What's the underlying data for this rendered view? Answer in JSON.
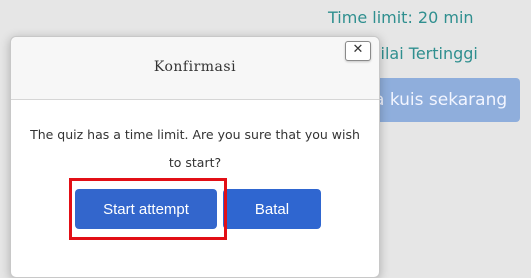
{
  "background": {
    "time_limit": "Time limit: 20 min",
    "grading_method": "hod: Nilai Tertinggi",
    "start_button_label": "a kuis sekarang"
  },
  "modal": {
    "title": "Konfirmasi",
    "close_symbol": "✕",
    "message": "The quiz has a time limit. Are you sure that you wish to start?",
    "primary_button": "Start attempt",
    "secondary_button": "Batal"
  },
  "colors": {
    "accent": "#3366cc",
    "highlight": "#e20f16"
  },
  "icons": {
    "close": "close-icon"
  }
}
